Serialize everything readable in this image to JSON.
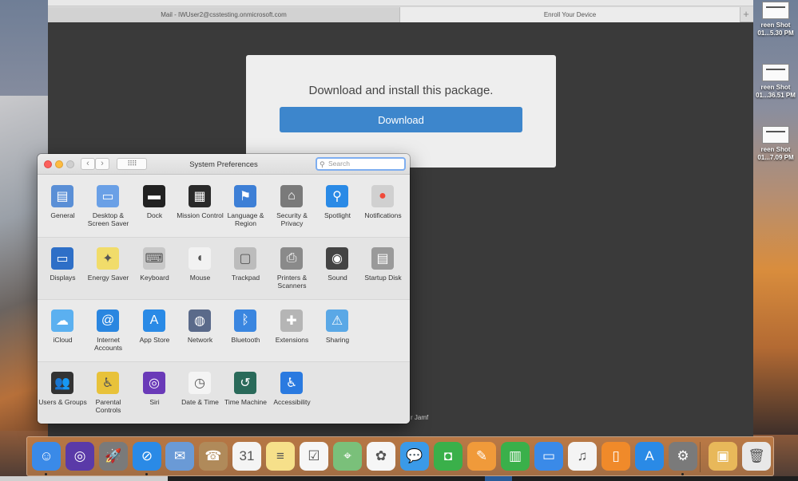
{
  "browser": {
    "tabs": [
      {
        "label": "Mail - IWUser2@csstesting.onmicrosoft.com"
      },
      {
        "label": "Enroll Your Device"
      }
    ],
    "add_tab": "+",
    "enroll": {
      "heading": "Download and install this package.",
      "button": "Download"
    },
    "footer_text": "r Jamf"
  },
  "desktop_icons": [
    {
      "line1": "reen Shot",
      "line2": "01...5.30 PM"
    },
    {
      "line1": "reen Shot",
      "line2": "01...36.51 PM"
    },
    {
      "line1": "reen Shot",
      "line2": "01...7.09 PM"
    }
  ],
  "system_preferences": {
    "title": "System Preferences",
    "search_placeholder": "Search",
    "back": "‹",
    "forward": "›",
    "grid": "⠿⠿",
    "rows": [
      [
        {
          "label": "General",
          "icon": "general-icon",
          "color": "#5a8fd6",
          "glyph": "▤"
        },
        {
          "label": "Desktop & Screen Saver",
          "icon": "desktop-screensaver-icon",
          "color": "#6aa0e6",
          "glyph": "▭"
        },
        {
          "label": "Dock",
          "icon": "dock-icon",
          "color": "#222222",
          "glyph": "▬"
        },
        {
          "label": "Mission Control",
          "icon": "mission-control-icon",
          "color": "#2a2a2a",
          "glyph": "▦"
        },
        {
          "label": "Language & Region",
          "icon": "language-region-icon",
          "color": "#3d7fd6",
          "glyph": "⚑"
        },
        {
          "label": "Security & Privacy",
          "icon": "security-privacy-icon",
          "color": "#7a7a7a",
          "glyph": "⌂"
        },
        {
          "label": "Spotlight",
          "icon": "spotlight-icon",
          "color": "#2a8ae6",
          "glyph": "⚲"
        },
        {
          "label": "Notifications",
          "icon": "notifications-icon",
          "color": "#d0d0d0",
          "glyph": "●"
        }
      ],
      [
        {
          "label": "Displays",
          "icon": "displays-icon",
          "color": "#2e6fc7",
          "glyph": "▭"
        },
        {
          "label": "Energy Saver",
          "icon": "energy-saver-icon",
          "color": "#f1dc6a",
          "glyph": "✦"
        },
        {
          "label": "Keyboard",
          "icon": "keyboard-icon",
          "color": "#c8c8c8",
          "glyph": "⌨"
        },
        {
          "label": "Mouse",
          "icon": "mouse-icon",
          "color": "#f2f2f2",
          "glyph": "◖"
        },
        {
          "label": "Trackpad",
          "icon": "trackpad-icon",
          "color": "#bcbcbc",
          "glyph": "▢"
        },
        {
          "label": "Printers & Scanners",
          "icon": "printers-scanners-icon",
          "color": "#8a8a8a",
          "glyph": "⎙"
        },
        {
          "label": "Sound",
          "icon": "sound-icon",
          "color": "#444444",
          "glyph": "◉"
        },
        {
          "label": "Startup Disk",
          "icon": "startup-disk-icon",
          "color": "#9a9a9a",
          "glyph": "▤"
        }
      ],
      [
        {
          "label": "iCloud",
          "icon": "icloud-icon",
          "color": "#5bb0f0",
          "glyph": "☁"
        },
        {
          "label": "Internet Accounts",
          "icon": "internet-accounts-icon",
          "color": "#2a86e0",
          "glyph": "@"
        },
        {
          "label": "App Store",
          "icon": "app-store-icon",
          "color": "#2a8ae6",
          "glyph": "A"
        },
        {
          "label": "Network",
          "icon": "network-icon",
          "color": "#5a6a8a",
          "glyph": "◍"
        },
        {
          "label": "Bluetooth",
          "icon": "bluetooth-icon",
          "color": "#3a86e0",
          "glyph": "ᛒ"
        },
        {
          "label": "Extensions",
          "icon": "extensions-icon",
          "color": "#b5b5b5",
          "glyph": "✚"
        },
        {
          "label": "Sharing",
          "icon": "sharing-icon",
          "color": "#5aa8e6",
          "glyph": "⚠"
        }
      ],
      [
        {
          "label": "Users & Groups",
          "icon": "users-groups-icon",
          "color": "#333333",
          "glyph": "👥"
        },
        {
          "label": "Parental Controls",
          "icon": "parental-controls-icon",
          "color": "#e8c23a",
          "glyph": "♿"
        },
        {
          "label": "Siri",
          "icon": "siri-icon",
          "color": "#6a3ab8",
          "glyph": "◎"
        },
        {
          "label": "Date & Time",
          "icon": "date-time-icon",
          "color": "#f4f4f4",
          "glyph": "◷"
        },
        {
          "label": "Time Machine",
          "icon": "time-machine-icon",
          "color": "#2a6a5a",
          "glyph": "↺"
        },
        {
          "label": "Accessibility",
          "icon": "accessibility-icon",
          "color": "#2a7ae0",
          "glyph": "♿"
        }
      ]
    ]
  },
  "dock": [
    {
      "name": "finder-icon",
      "color": "#3a8ae8",
      "glyph": "☺"
    },
    {
      "name": "siri-icon",
      "color": "#5a3aa8",
      "glyph": "◎"
    },
    {
      "name": "launchpad-icon",
      "color": "#7a7a7a",
      "glyph": "🚀"
    },
    {
      "name": "safari-icon",
      "color": "#2a8ae6",
      "glyph": "⊘"
    },
    {
      "name": "mail-icon",
      "color": "#6a9ad6",
      "glyph": "✉"
    },
    {
      "name": "contacts-icon",
      "color": "#b08a5a",
      "glyph": "☎"
    },
    {
      "name": "calendar-icon",
      "color": "#f4f4f4",
      "glyph": "31"
    },
    {
      "name": "notes-icon",
      "color": "#f6e08a",
      "glyph": "≡"
    },
    {
      "name": "reminders-icon",
      "color": "#f6f6f6",
      "glyph": "☑"
    },
    {
      "name": "maps-icon",
      "color": "#7ac07a",
      "glyph": "⌖"
    },
    {
      "name": "photos-icon",
      "color": "#f6f6f6",
      "glyph": "✿"
    },
    {
      "name": "messages-icon",
      "color": "#3a9ae8",
      "glyph": "💬"
    },
    {
      "name": "facetime-icon",
      "color": "#3ab04a",
      "glyph": "◘"
    },
    {
      "name": "pages-icon",
      "color": "#f09a3a",
      "glyph": "✎"
    },
    {
      "name": "numbers-icon",
      "color": "#3ab04a",
      "glyph": "▥"
    },
    {
      "name": "keynote-icon",
      "color": "#3a8ae8",
      "glyph": "▭"
    },
    {
      "name": "itunes-icon",
      "color": "#f4f4f4",
      "glyph": "♫"
    },
    {
      "name": "ibooks-icon",
      "color": "#f08a2a",
      "glyph": "▯"
    },
    {
      "name": "app-store-icon",
      "color": "#2a8ae6",
      "glyph": "A"
    },
    {
      "name": "system-preferences-icon",
      "color": "#7a7a7a",
      "glyph": "⚙"
    },
    {
      "name": "downloads-folder-icon",
      "color": "#e8b85a",
      "glyph": "▣"
    },
    {
      "name": "trash-icon",
      "color": "#e8e8e8",
      "glyph": "🗑"
    }
  ]
}
